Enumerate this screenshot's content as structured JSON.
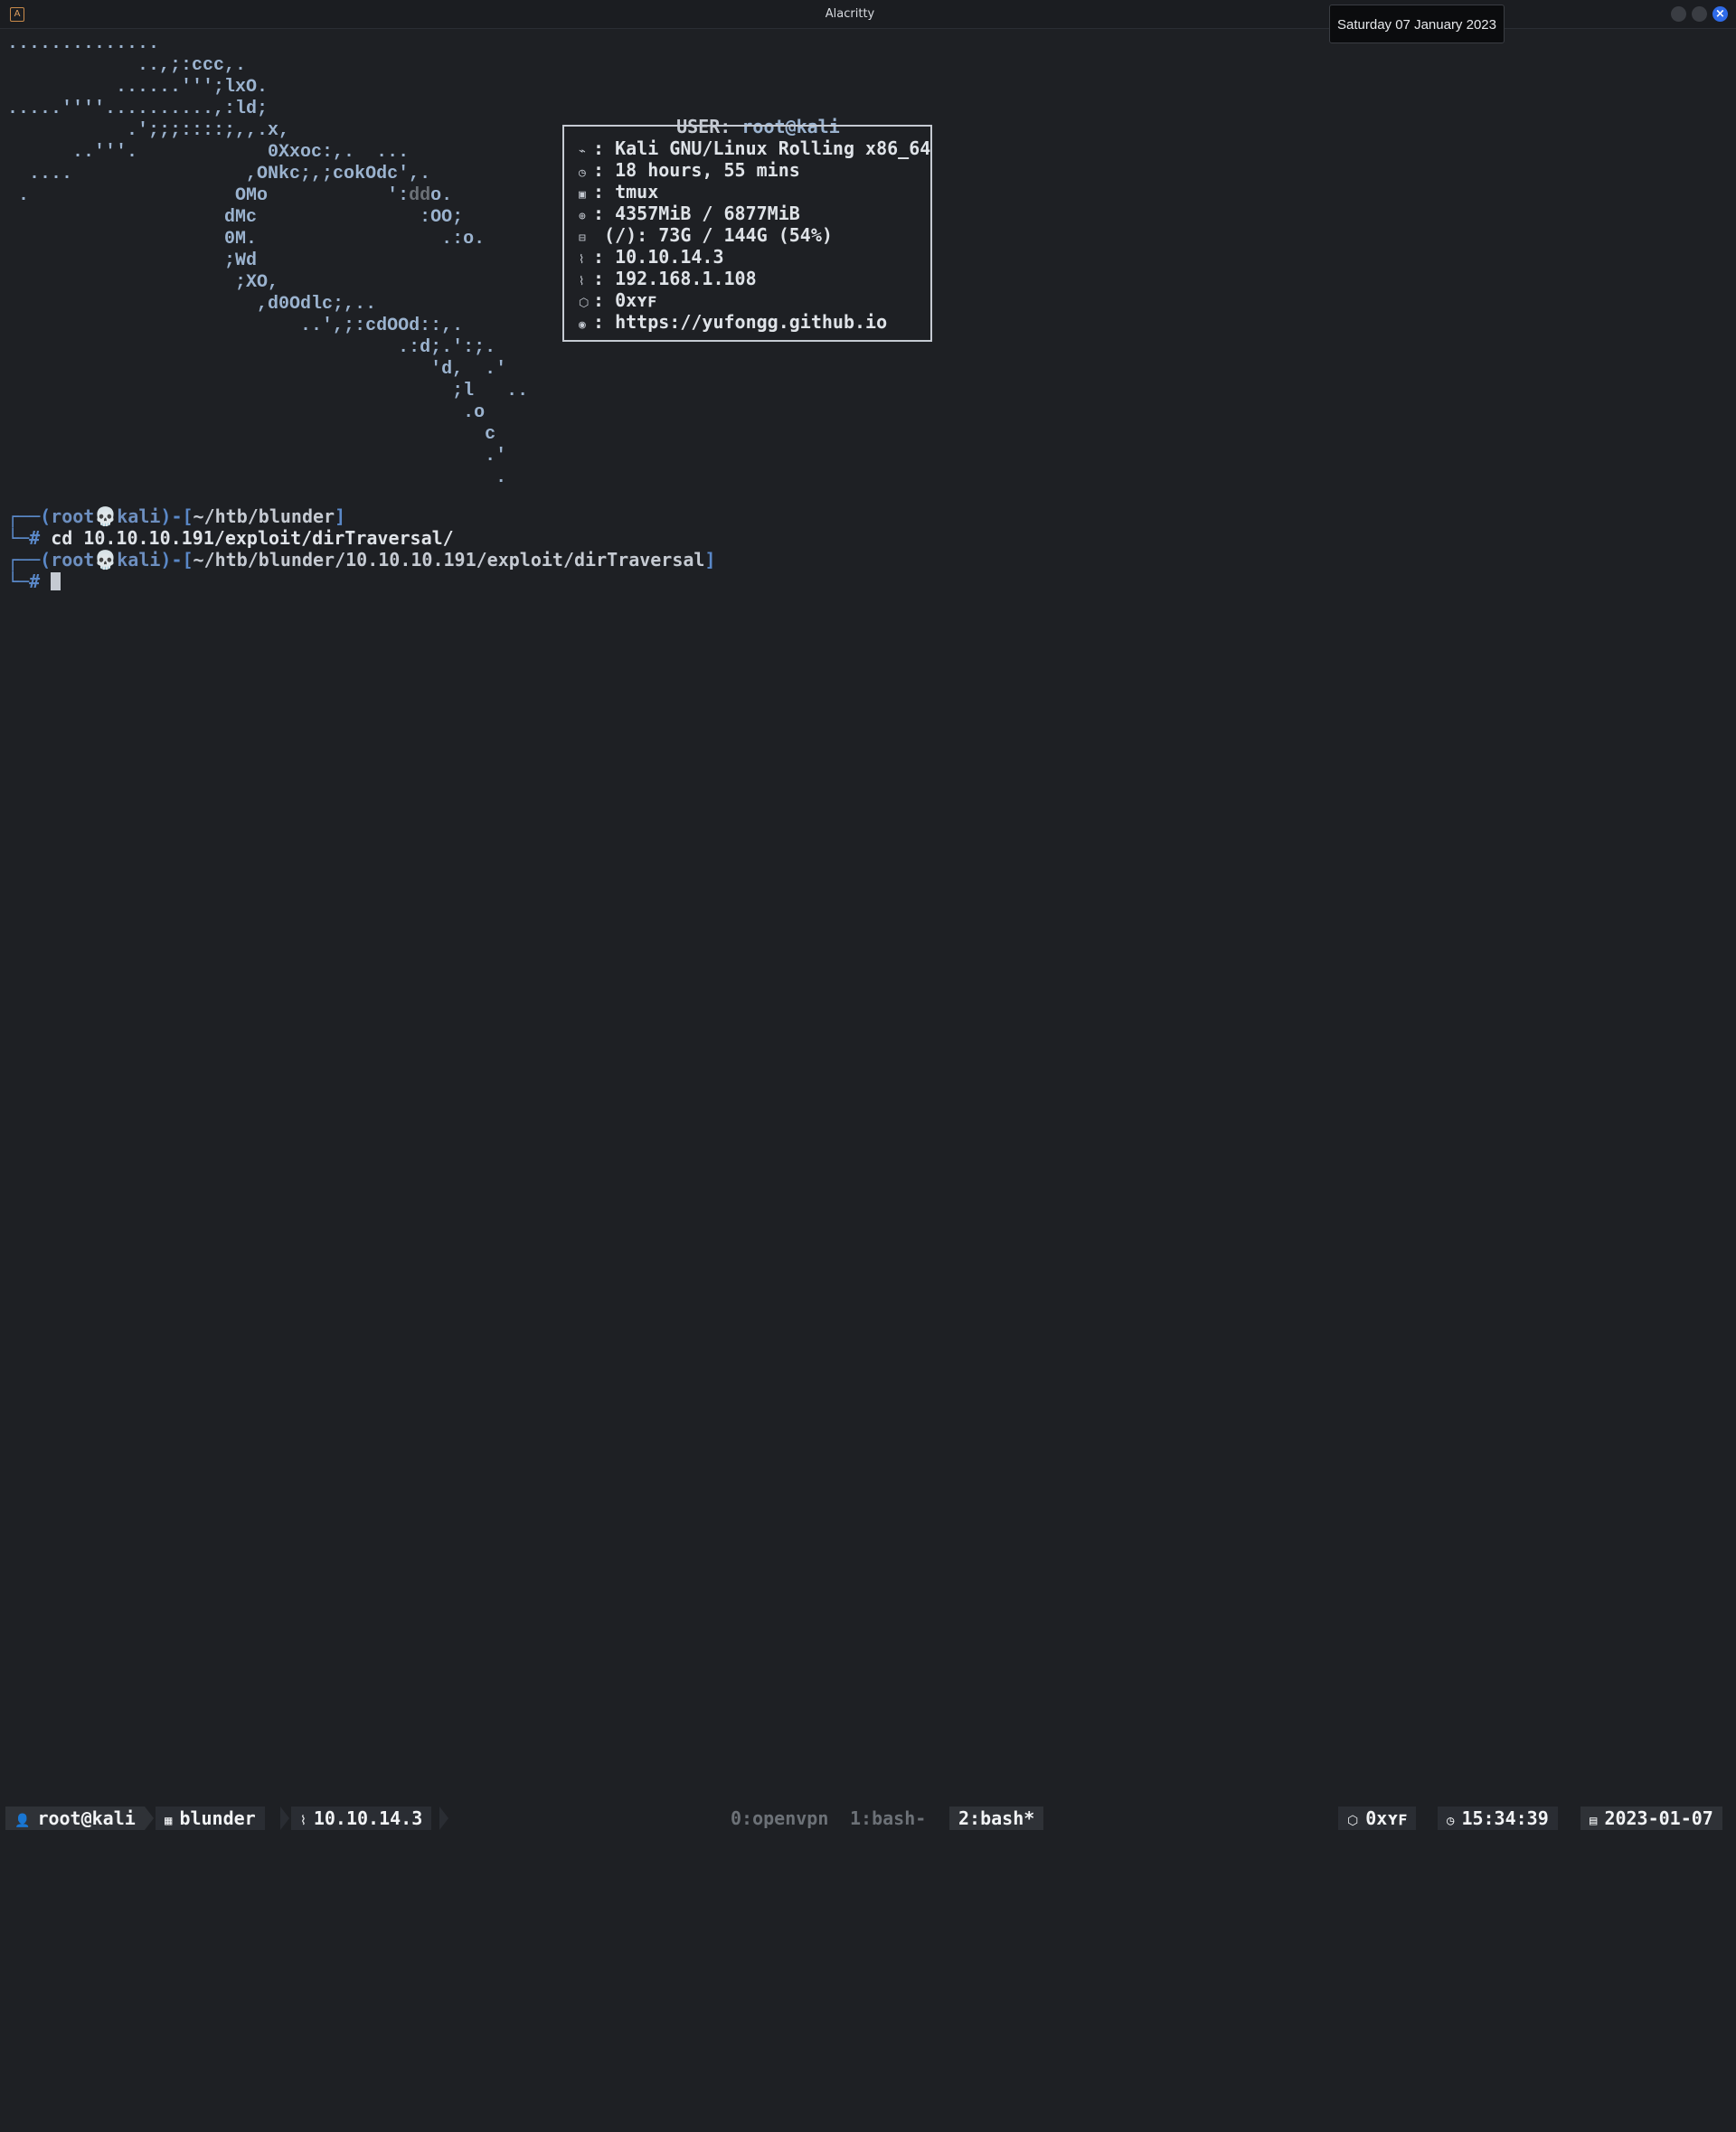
{
  "window": {
    "title": "Alacritty",
    "tooltip": "Saturday 07 January 2023"
  },
  "ascii_art": [
    "..............",
    "            ..,;:ccc,.",
    "          ......''';lxO.",
    ".....''''..........,:ld;",
    "           .';;;::::;,,.x,",
    "      ..'''.            0Xxoc:,.  ...",
    "  ....                ,ONkc;,;cokOdc',.",
    " .                   OMo           ':",
    "                    dMc               :OO;",
    "                    0M.                 .:o.",
    "                    ;Wd",
    "                     ;XO,",
    "                       ,d0Odlc;,..",
    "                           ..',;:cdOOd::,.",
    "                                    .:d;.':;.",
    "                                       'd,  .'",
    "                                         ;l   ..",
    "                                          .o",
    "                                            c",
    "                                            .'",
    "                                             ."
  ],
  "ascii_dim": "dd",
  "ascii_after_dim": "o.",
  "fetch": {
    "user_label": "USER:",
    "user_value": "root@kali",
    "rows": [
      {
        "icon": "distro-icon",
        "glyph": "⌁",
        "label": ":",
        "value": " Kali GNU/Linux Rolling x86_64"
      },
      {
        "icon": "uptime-icon",
        "glyph": "◷",
        "label": ":",
        "value": " 18 hours, 55 mins"
      },
      {
        "icon": "terminal-icon",
        "glyph": "▣",
        "label": ":",
        "value": " tmux"
      },
      {
        "icon": "memory-icon",
        "glyph": "⊕",
        "label": ":",
        "value": " 4357MiB / 6877MiB"
      },
      {
        "icon": "disk-icon",
        "glyph": "⊟",
        "label": "",
        "value": " (/): 73G / 144G (54%)"
      },
      {
        "icon": "network-icon",
        "glyph": "⌇",
        "label": ":",
        "value": " 10.10.14.3"
      },
      {
        "icon": "network-icon",
        "glyph": "⌇",
        "label": ":",
        "value": " 192.168.1.108"
      },
      {
        "icon": "cube-icon",
        "glyph": "⬡",
        "label": ":",
        "value": " 0xʏꜰ"
      },
      {
        "icon": "github-icon",
        "glyph": "◉",
        "label": ":",
        "value": " https://yufongg.github.io"
      }
    ]
  },
  "terminal": {
    "prompt1_path": "~/htb/blunder",
    "command1": "cd 10.10.10.191/exploit/dirTraversal/",
    "prompt2_path": "~/htb/blunder/10.10.10.191/exploit/dirTraversal",
    "prompt_user": "root",
    "prompt_host": "kali",
    "prompt_char": "#"
  },
  "statusbar": {
    "user": "root@kali",
    "session": "blunder",
    "ip": "10.10.14.3",
    "windows": [
      "0:openvpn",
      "1:bash-",
      "2:bash*"
    ],
    "handle": "0xʏꜰ",
    "time": "15:34:39",
    "date": "2023-01-07"
  }
}
